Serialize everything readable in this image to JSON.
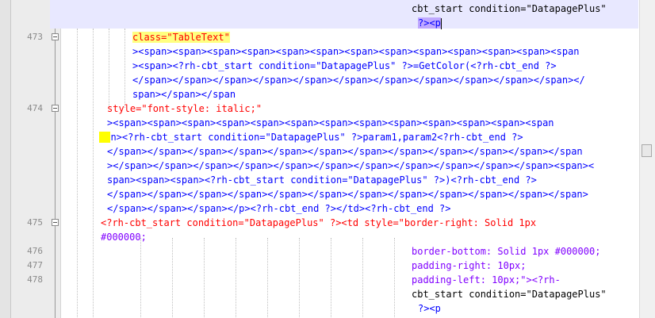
{
  "line_numbers": [
    "473",
    "474",
    "475",
    "476",
    "477",
    "478"
  ],
  "lines": {
    "l0a": "cbt_start condition=\"DatapagePlus\"",
    "l0b": "?><p",
    "l1a": "class=\"TableText\"",
    "l1b": "><span><span><span><span><span><span><span><span><span><span><span><span><span",
    "l1c": "><span><?rh-cbt_start condition=\"DatapagePlus\" ?>=GetColor(<?rh-cbt_end ?>",
    "l1d": "</span></span></span></span></span></span></span></span></span></span></span></",
    "l1e": "span></span></span",
    "l2a": "style=\"font-style: italic;\"",
    "l2b": "><span><span><span><span><span><span><span><span><span><span><span><span><span",
    "l2c": "n><?rh-cbt_start condition=\"DatapagePlus\" ?>param1,param2<?rh-cbt_end ?>",
    "l2d": "</span></span></span></span></span></span></span></span></span></span></span></span",
    "l2e": "></span></span></span></span></span></span></span></span></span></span></span><span><",
    "l2f": "span><span><span><?rh-cbt_start condition=\"DatapagePlus\" ?>)<?rh-cbt_end ?>",
    "l2g": "</span></span></span></span></span></span></span></span></span></span></span></span>",
    "l2h": "</span></span></span></p><?rh-cbt_end ?></td><?rh-cbt_end ?>",
    "l3a": "<?rh-cbt_start condition=\"DatapagePlus\" ?><td style=\"border-right: Solid 1px",
    "l3b": "#000000;",
    "l4a": "border-bottom: Solid 1px #000000;",
    "l5a": "padding-right: 10px;",
    "l6a": "padding-left: 10px;\"><?rh-",
    "l6b": "cbt_start condition=\"DatapagePlus\"",
    "l6c": "?><p"
  },
  "colors": {
    "tag": "#0000ff",
    "processing_instruction": "#ff0000",
    "string": "#8000ff",
    "current_line": "#e8e8ff",
    "brace_match": "#bfa8ff",
    "highlight": "#ffff80"
  }
}
